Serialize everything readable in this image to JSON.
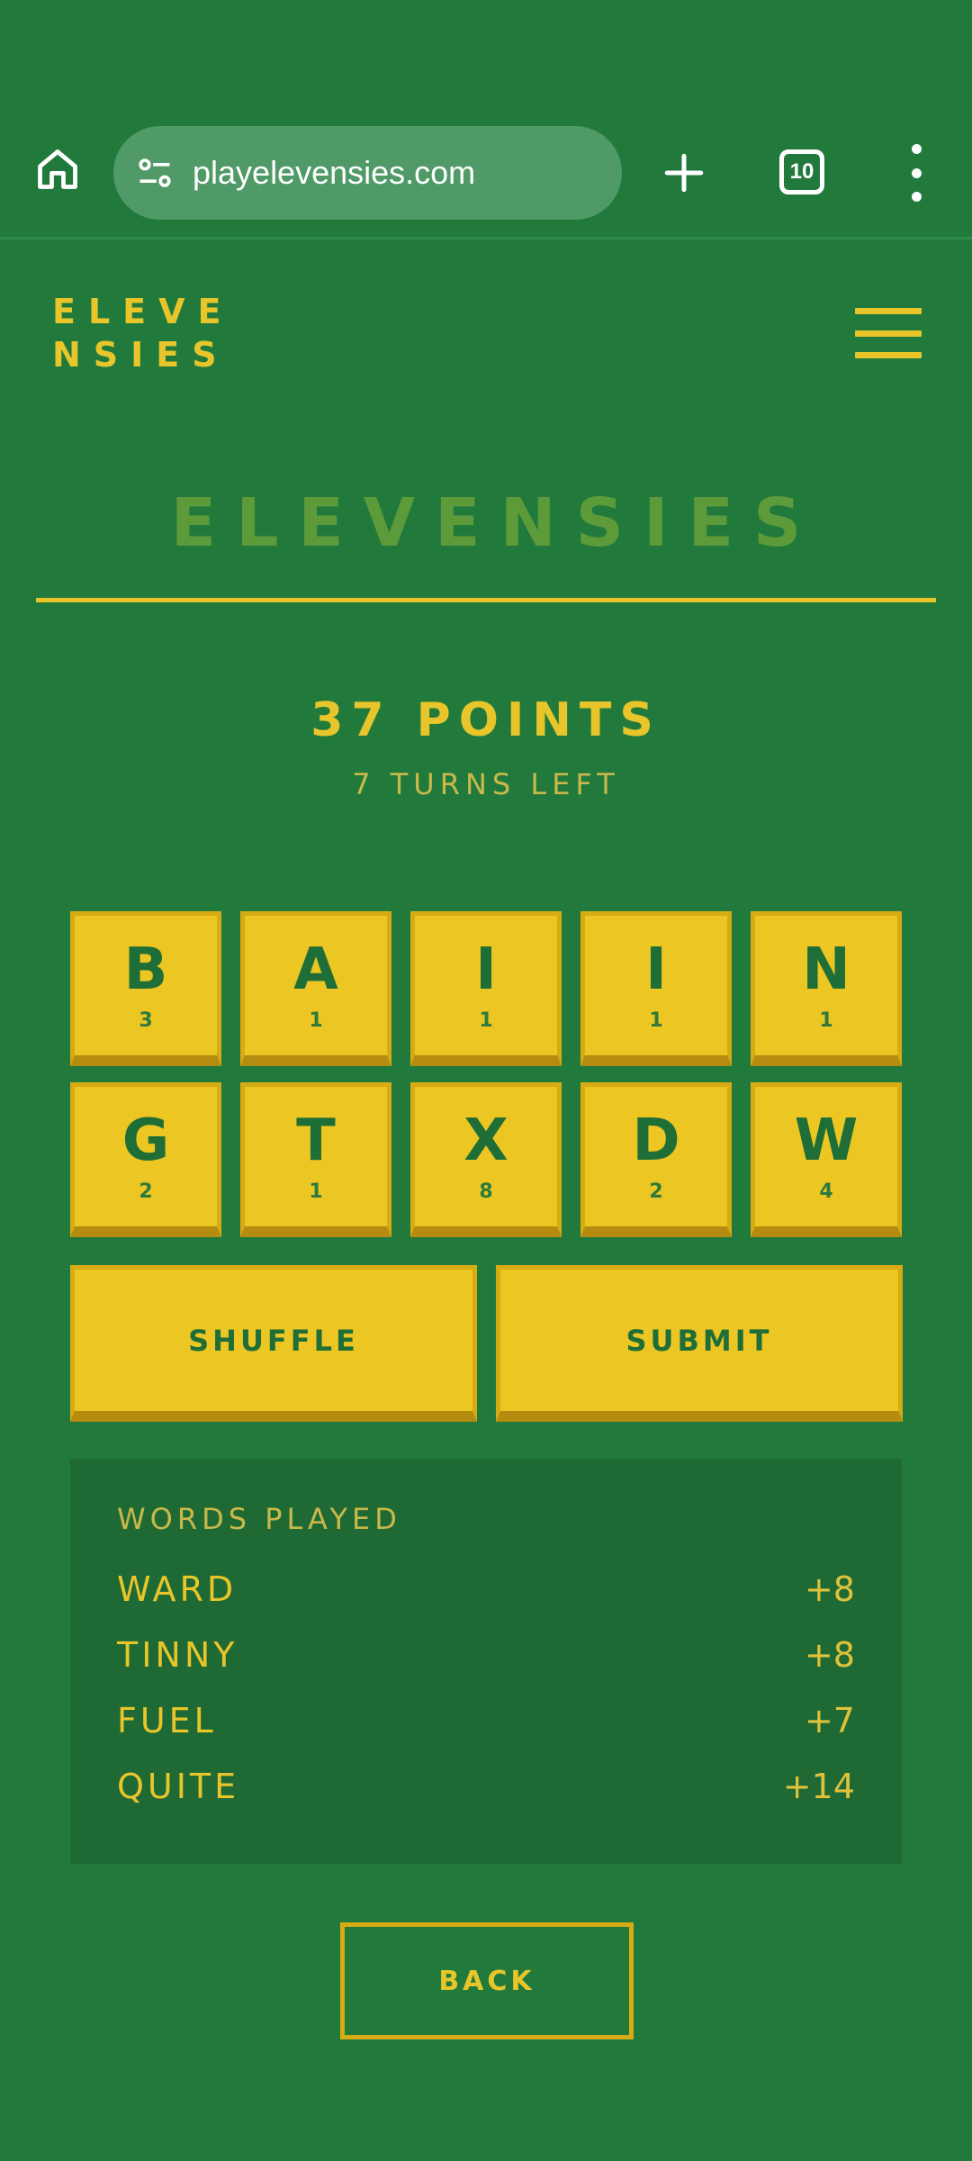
{
  "browser": {
    "url": "playelevensies.com",
    "tab_count": "10"
  },
  "site": {
    "logo_line1": "ELEVE",
    "logo_line2": "NSIES",
    "title": "ELEVENSIES"
  },
  "game": {
    "points": "37 POINTS",
    "turns": "7 TURNS LEFT",
    "tiles_row1": [
      {
        "letter": "B",
        "score": "3"
      },
      {
        "letter": "A",
        "score": "1"
      },
      {
        "letter": "I",
        "score": "1"
      },
      {
        "letter": "I",
        "score": "1"
      },
      {
        "letter": "N",
        "score": "1"
      }
    ],
    "tiles_row2": [
      {
        "letter": "G",
        "score": "2"
      },
      {
        "letter": "T",
        "score": "1"
      },
      {
        "letter": "X",
        "score": "8"
      },
      {
        "letter": "D",
        "score": "2"
      },
      {
        "letter": "W",
        "score": "4"
      }
    ],
    "shuffle_label": "SHUFFLE",
    "submit_label": "SUBMIT"
  },
  "words_played": {
    "heading": "WORDS PLAYED",
    "items": [
      {
        "word": "WARD",
        "points": "+8"
      },
      {
        "word": "TINNY",
        "points": "+8"
      },
      {
        "word": "FUEL",
        "points": "+7"
      },
      {
        "word": "QUITE",
        "points": "+14"
      }
    ]
  },
  "back_label": "BACK",
  "colors": {
    "background": "#217a3c",
    "accent": "#e8c52a",
    "tile": "#ecc623",
    "panel": "#1f6934"
  }
}
